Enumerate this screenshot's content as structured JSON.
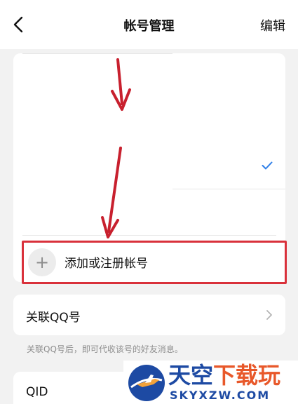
{
  "header": {
    "title": "帐号管理",
    "edit_label": "编辑"
  },
  "accounts": {
    "add_label": "添加或注册帐号"
  },
  "linked_qq": {
    "label": "关联QQ号",
    "hint": "关联QQ号后，即可代收该号的好友消息。"
  },
  "qid": {
    "label": "QID"
  },
  "watermark": {
    "title_main": "天空",
    "title_accent": "下载玩",
    "subtitle": "SKYXZW.COM"
  },
  "colors": {
    "highlight_red": "#d9313b",
    "arrow_red": "#c8202e",
    "check_blue": "#2f7fe8",
    "watermark_blue": "#1d4aa3",
    "watermark_orange": "#e8582a"
  }
}
